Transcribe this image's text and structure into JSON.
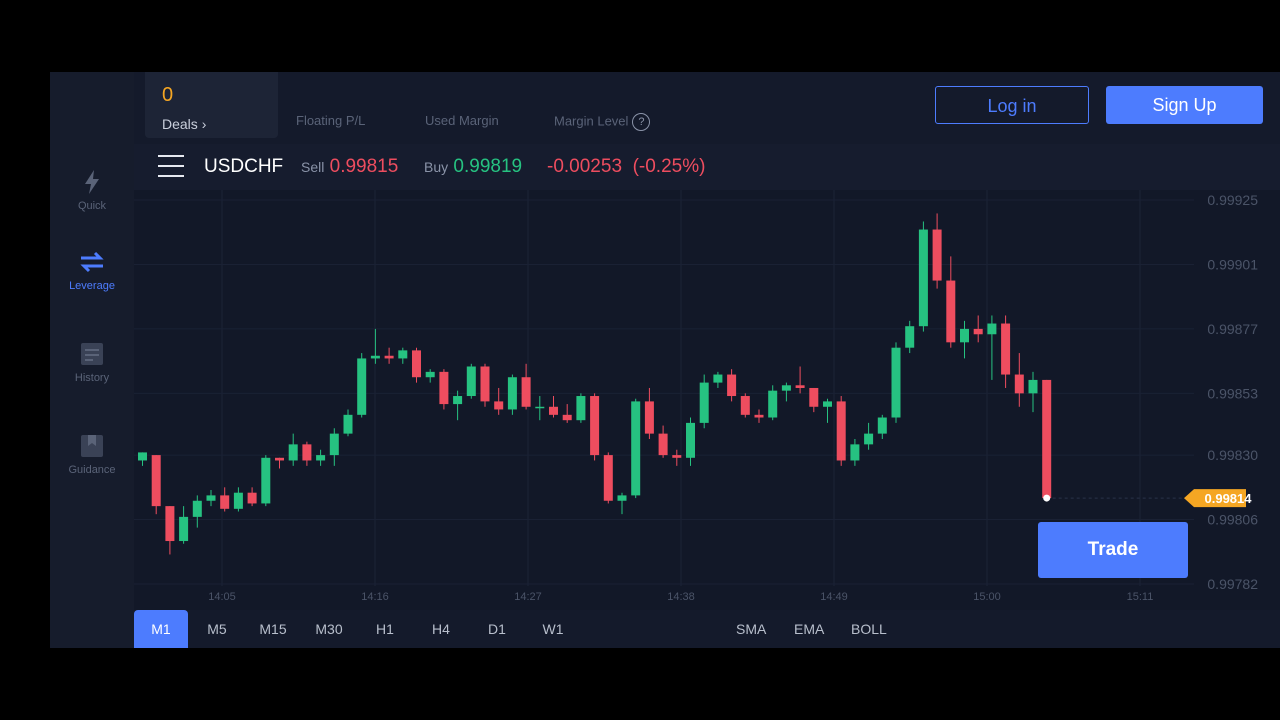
{
  "sidebar": {
    "items": [
      {
        "label": "Quick",
        "icon": "lightning-icon",
        "active": false
      },
      {
        "label": "Leverage",
        "icon": "swap-arrows-icon",
        "active": true
      },
      {
        "label": "History",
        "icon": "history-icon",
        "active": false
      },
      {
        "label": "Guidance",
        "icon": "bookmark-icon",
        "active": false
      }
    ]
  },
  "header": {
    "deals_count": "0",
    "deals_label": "Deals",
    "floating_pl": "Floating P/L",
    "used_margin": "Used Margin",
    "margin_level": "Margin Level",
    "login": "Log in",
    "signup": "Sign Up"
  },
  "symbol_bar": {
    "symbol": "USDCHF",
    "sell_label": "Sell",
    "sell_price": "0.99815",
    "buy_label": "Buy",
    "buy_price": "0.99819",
    "change": "-0.00253",
    "change_pct": "(-0.25%)"
  },
  "colors": {
    "up": "#26c281",
    "down": "#ee4d5f",
    "accent": "#4d7cfe",
    "price_tag": "#f5a623"
  },
  "chart_data": {
    "type": "candlestick",
    "y_ticks": [
      "0.99925",
      "0.99901",
      "0.99877",
      "0.99853",
      "0.99830",
      "0.99806",
      "0.99782"
    ],
    "x_ticks": [
      "14:05",
      "14:16",
      "14:27",
      "14:38",
      "14:49",
      "15:00",
      "15:11"
    ],
    "current_price": "0.99814",
    "ylim": [
      0.99782,
      0.99925
    ],
    "candles": [
      [
        0.99828,
        0.99831,
        0.99826,
        0.99831
      ],
      [
        0.9983,
        0.9983,
        0.99808,
        0.99811
      ],
      [
        0.99811,
        0.99811,
        0.99793,
        0.99798
      ],
      [
        0.99798,
        0.99811,
        0.99797,
        0.99807
      ],
      [
        0.99807,
        0.99815,
        0.99803,
        0.99813
      ],
      [
        0.99813,
        0.99817,
        0.99811,
        0.99815
      ],
      [
        0.99815,
        0.99818,
        0.99809,
        0.9981
      ],
      [
        0.9981,
        0.99818,
        0.99809,
        0.99816
      ],
      [
        0.99816,
        0.99818,
        0.99811,
        0.99812
      ],
      [
        0.99812,
        0.9983,
        0.99811,
        0.99829
      ],
      [
        0.99829,
        0.99829,
        0.99825,
        0.99828
      ],
      [
        0.99828,
        0.99838,
        0.99826,
        0.99834
      ],
      [
        0.99834,
        0.99835,
        0.99826,
        0.99828
      ],
      [
        0.99828,
        0.99832,
        0.99826,
        0.9983
      ],
      [
        0.9983,
        0.9984,
        0.99826,
        0.99838
      ],
      [
        0.99838,
        0.99847,
        0.99837,
        0.99845
      ],
      [
        0.99845,
        0.99868,
        0.99844,
        0.99866
      ],
      [
        0.99866,
        0.99877,
        0.99864,
        0.99867
      ],
      [
        0.99867,
        0.9987,
        0.99864,
        0.99866
      ],
      [
        0.99866,
        0.9987,
        0.99864,
        0.99869
      ],
      [
        0.99869,
        0.9987,
        0.99857,
        0.99859
      ],
      [
        0.99859,
        0.99862,
        0.99857,
        0.99861
      ],
      [
        0.99861,
        0.99862,
        0.99847,
        0.99849
      ],
      [
        0.99849,
        0.99854,
        0.99843,
        0.99852
      ],
      [
        0.99852,
        0.99864,
        0.99851,
        0.99863
      ],
      [
        0.99863,
        0.99864,
        0.99848,
        0.9985
      ],
      [
        0.9985,
        0.99855,
        0.99845,
        0.99847
      ],
      [
        0.99847,
        0.9986,
        0.99845,
        0.99859
      ],
      [
        0.99859,
        0.99864,
        0.99847,
        0.99848
      ],
      [
        0.99848,
        0.99852,
        0.99843,
        0.99848
      ],
      [
        0.99848,
        0.99852,
        0.99844,
        0.99845
      ],
      [
        0.99845,
        0.99849,
        0.99842,
        0.99843
      ],
      [
        0.99843,
        0.99853,
        0.99842,
        0.99852
      ],
      [
        0.99852,
        0.99853,
        0.99828,
        0.9983
      ],
      [
        0.9983,
        0.99831,
        0.99812,
        0.99813
      ],
      [
        0.99813,
        0.99816,
        0.99808,
        0.99815
      ],
      [
        0.99815,
        0.99851,
        0.99814,
        0.9985
      ],
      [
        0.9985,
        0.99855,
        0.99836,
        0.99838
      ],
      [
        0.99838,
        0.99841,
        0.99829,
        0.9983
      ],
      [
        0.9983,
        0.99832,
        0.99826,
        0.99829
      ],
      [
        0.99829,
        0.99844,
        0.99826,
        0.99842
      ],
      [
        0.99842,
        0.9986,
        0.9984,
        0.99857
      ],
      [
        0.99857,
        0.99861,
        0.99855,
        0.9986
      ],
      [
        0.9986,
        0.99862,
        0.9985,
        0.99852
      ],
      [
        0.99852,
        0.99853,
        0.99844,
        0.99845
      ],
      [
        0.99845,
        0.99847,
        0.99842,
        0.99844
      ],
      [
        0.99844,
        0.99856,
        0.99843,
        0.99854
      ],
      [
        0.99854,
        0.99857,
        0.9985,
        0.99856
      ],
      [
        0.99856,
        0.99863,
        0.99853,
        0.99855
      ],
      [
        0.99855,
        0.99855,
        0.99846,
        0.99848
      ],
      [
        0.99848,
        0.99851,
        0.99842,
        0.9985
      ],
      [
        0.9985,
        0.99852,
        0.99826,
        0.99828
      ],
      [
        0.99828,
        0.99836,
        0.99826,
        0.99834
      ],
      [
        0.99834,
        0.99842,
        0.99832,
        0.99838
      ],
      [
        0.99838,
        0.99845,
        0.99836,
        0.99844
      ],
      [
        0.99844,
        0.99872,
        0.99842,
        0.9987
      ],
      [
        0.9987,
        0.9988,
        0.99868,
        0.99878
      ],
      [
        0.99878,
        0.99917,
        0.99876,
        0.99914
      ],
      [
        0.99914,
        0.9992,
        0.99892,
        0.99895
      ],
      [
        0.99895,
        0.99904,
        0.9987,
        0.99872
      ],
      [
        0.99872,
        0.9988,
        0.99866,
        0.99877
      ],
      [
        0.99877,
        0.99882,
        0.99872,
        0.99875
      ],
      [
        0.99875,
        0.99882,
        0.99858,
        0.99879
      ],
      [
        0.99879,
        0.99882,
        0.99855,
        0.9986
      ],
      [
        0.9986,
        0.99868,
        0.99848,
        0.99853
      ],
      [
        0.99853,
        0.99861,
        0.99846,
        0.99858
      ],
      [
        0.99858,
        0.99858,
        0.99814,
        0.99814
      ]
    ]
  },
  "timeframes": [
    "M1",
    "M5",
    "M15",
    "M30",
    "H1",
    "H4",
    "D1",
    "W1"
  ],
  "active_timeframe": "M1",
  "indicators": [
    "SMA",
    "EMA",
    "BOLL"
  ],
  "trade_button": "Trade"
}
